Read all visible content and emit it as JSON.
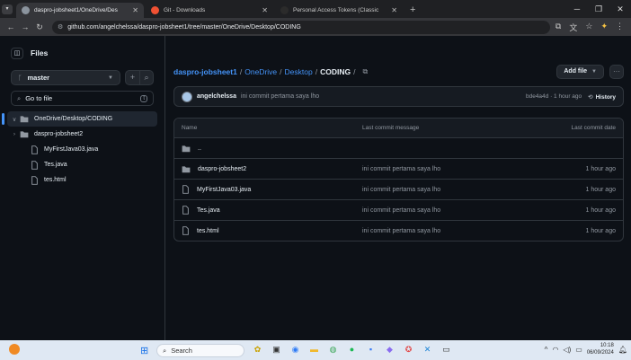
{
  "browser": {
    "tabs": [
      {
        "label": "daspro-jobsheet1/OneDrive/Des",
        "active": true,
        "icon_color": "#8b949e"
      },
      {
        "label": "Git - Downloads",
        "active": false,
        "icon_color": "#f05133"
      },
      {
        "label": "Personal Access Tokens (Classic",
        "active": false,
        "icon_color": "#2b2b2b"
      }
    ],
    "new_tab": "+",
    "url": "github.com/angelchelssa/daspro-jobsheet1/tree/master/OneDrive/Desktop/CODING"
  },
  "sidebar": {
    "title": "Files",
    "branch": "master",
    "search_placeholder": "Go to file",
    "search_shortcut": "t",
    "tree": [
      {
        "label": "OneDrive/Desktop/CODING",
        "type": "folder",
        "selected": true,
        "chevron": "∨"
      },
      {
        "label": "daspro-jobsheet2",
        "type": "folder",
        "selected": false,
        "chevron": "›"
      },
      {
        "label": "MyFirstJava03.java",
        "type": "file",
        "selected": false,
        "chevron": ""
      },
      {
        "label": "Tes.java",
        "type": "file",
        "selected": false,
        "chevron": ""
      },
      {
        "label": "tes.html",
        "type": "file",
        "selected": false,
        "chevron": ""
      }
    ]
  },
  "breadcrumb": {
    "repo": "daspro-jobsheet1",
    "parts": [
      "OneDrive",
      "Desktop"
    ],
    "current": "CODING",
    "trailing": "/"
  },
  "actions": {
    "add_file": "Add file",
    "more": "···"
  },
  "commit": {
    "author": "angelchelssa",
    "message": "ini commit pertama saya lho",
    "meta": "bde4a4d · 1 hour ago",
    "history": "History"
  },
  "table": {
    "headers": {
      "name": "Name",
      "message": "Last commit message",
      "date": "Last commit date"
    },
    "rows": [
      {
        "name": "..",
        "type": "folder",
        "message": "",
        "date": ""
      },
      {
        "name": "daspro-jobsheet2",
        "type": "folder",
        "message": "ini commit pertama saya lho",
        "date": "1 hour ago"
      },
      {
        "name": "MyFirstJava03.java",
        "type": "file",
        "message": "ini commit pertama saya lho",
        "date": "1 hour ago"
      },
      {
        "name": "Tes.java",
        "type": "file",
        "message": "ini commit pertama saya lho",
        "date": "1 hour ago"
      },
      {
        "name": "tes.html",
        "type": "file",
        "message": "ini commit pertama saya lho",
        "date": "1 hour ago"
      }
    ]
  },
  "taskbar": {
    "search": "Search",
    "time": "10:18",
    "date": "06/09/2024"
  },
  "colors": {
    "accent": "#4493f8",
    "bg": "#0d1117",
    "border": "#30363d"
  }
}
